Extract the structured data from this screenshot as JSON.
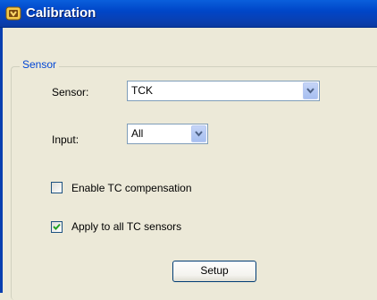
{
  "window": {
    "title": "Calibration"
  },
  "group": {
    "label": "Sensor"
  },
  "sensor": {
    "label": "Sensor:",
    "value": "TCK"
  },
  "input": {
    "label": "Input:",
    "value": "All"
  },
  "enable_tc": {
    "label": "Enable TC compensation",
    "checked": false
  },
  "apply_all": {
    "label": "Apply to all TC sensors",
    "checked": true
  },
  "setup": {
    "label": "Setup"
  },
  "icons": {
    "window": "app-icon",
    "dropdown": "chevron-down-icon",
    "check": "checkmark-icon"
  },
  "colors": {
    "titlebar": "#0046c8",
    "dialog_bg": "#ece9d8",
    "group_label": "#0046d5"
  }
}
